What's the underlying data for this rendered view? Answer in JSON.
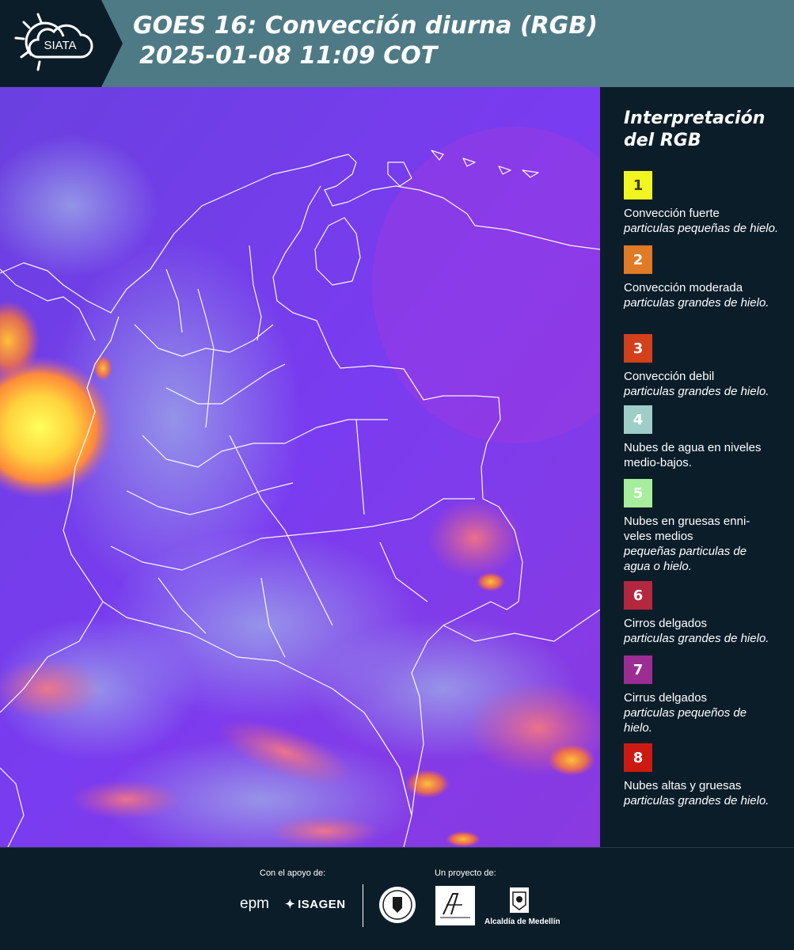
{
  "header": {
    "logo_text": "SIATA",
    "title_line1": "GOES 16: Convección diurna (RGB)",
    "title_line2": "2025-01-08 11:09 COT"
  },
  "map": {
    "background_color": "#7a3cf0",
    "border_color": "#ffffff"
  },
  "legend": {
    "title": "Interpretación del RGB",
    "items": [
      {
        "number": "1",
        "color": "#f2f51f",
        "number_color": "#3b3b1a",
        "name": "Convección fuerte",
        "desc": "particulas pequeñas de hielo."
      },
      {
        "number": "2",
        "color": "#e07a24",
        "number_color": "#ffffff",
        "name": "Convección moderada",
        "desc": "particulas grandes de hielo."
      },
      {
        "number": "3",
        "color": "#d2401c",
        "number_color": "#ffffff",
        "name": "Convección debil",
        "desc": "particulas grandes de hielo."
      },
      {
        "number": "4",
        "color": "#9fcdc7",
        "number_color": "#ffffff",
        "name": "Nubes de agua en niveles medio-bajos.",
        "desc": ""
      },
      {
        "number": "5",
        "color": "#a6ee9b",
        "number_color": "#ffffff",
        "name": "Nubes en gruesas enni-veles medios",
        "desc": "pequeñas particulas de agua o hielo."
      },
      {
        "number": "6",
        "color": "#b3273f",
        "number_color": "#ffffff",
        "name": "Cirros delgados",
        "desc": "particulas grandes de hielo."
      },
      {
        "number": "7",
        "color": "#9b2d93",
        "number_color": "#ffffff",
        "name": "Cirrus delgados",
        "desc": "particulas pequeños de hielo."
      },
      {
        "number": "8",
        "color": "#cc1a12",
        "number_color": "#ffffff",
        "name": "Nubes altas y gruesas",
        "desc": "particulas grandes de hielo."
      }
    ]
  },
  "footer": {
    "support_label": "Con el apoyo de:",
    "project_label": "Un proyecto de:",
    "epm": "epm",
    "isagen": "ISAGEN",
    "medellin": "Alcaldía de Medellín"
  }
}
